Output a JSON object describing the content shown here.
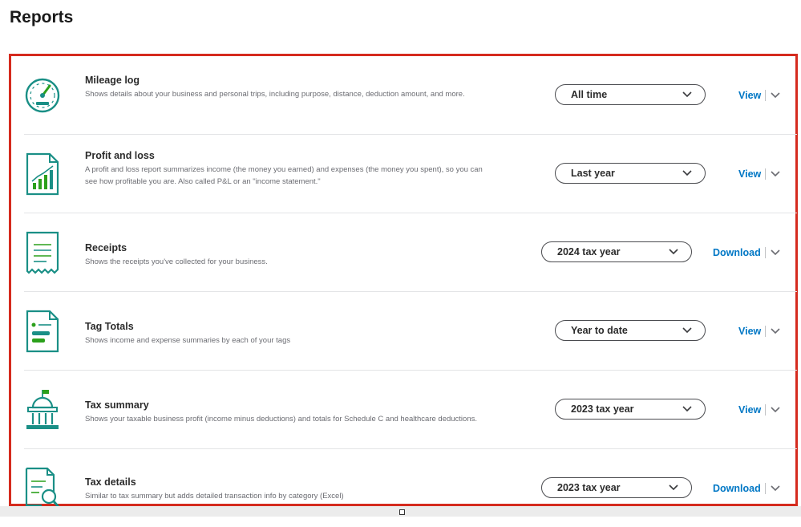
{
  "page": {
    "title": "Reports"
  },
  "reports": [
    {
      "name": "Mileage log",
      "description": "Shows details about your business and personal trips, including purpose, distance, deduction amount, and more.",
      "description_line2": "",
      "period": "All time",
      "action": "View",
      "icon": "speedometer-icon"
    },
    {
      "name": "Profit and loss",
      "description": "A profit and loss report summarizes income (the money you earned) and expenses (the money you spent), so you can",
      "description_line2": "see how profitable you are. Also called P&L or an \"income statement.\"",
      "period": "Last year",
      "action": "View",
      "icon": "growth-chart-icon"
    },
    {
      "name": "Receipts",
      "description": "Shows the receipts you've collected for your business.",
      "description_line2": "",
      "period": "2024 tax year",
      "action": "Download",
      "icon": "receipt-icon"
    },
    {
      "name": "Tag Totals",
      "description": "Shows income and expense summaries by each of your tags",
      "description_line2": "",
      "period": "Year to date",
      "action": "View",
      "icon": "tag-list-icon"
    },
    {
      "name": "Tax summary",
      "description": "Shows your taxable business profit (income minus deductions) and totals for Schedule C and healthcare deductions.",
      "description_line2": "",
      "period": "2023 tax year",
      "action": "View",
      "icon": "government-building-icon"
    },
    {
      "name": "Tax details",
      "description": "Similar to tax summary but adds detailed transaction info by category (Excel)",
      "description_line2": "",
      "period": "2023 tax year",
      "action": "Download",
      "icon": "document-search-icon"
    }
  ],
  "colors": {
    "highlight_border": "#d52b1e",
    "link": "#0077c5",
    "icon_teal": "#1a8f86",
    "icon_green": "#2ca01c"
  }
}
